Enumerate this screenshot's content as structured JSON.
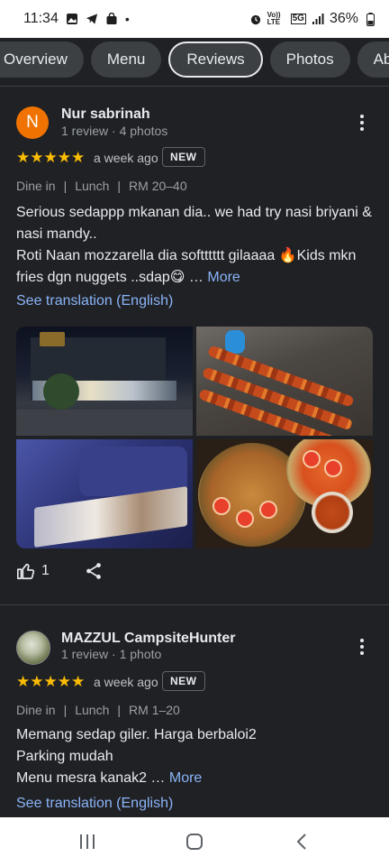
{
  "status_bar": {
    "time": "11:34",
    "notification_icons": [
      "image-icon",
      "telegram-icon",
      "shop-icon"
    ],
    "dot": "•",
    "right_icons": [
      "alarm-icon",
      "volte-icon",
      "5g-icon",
      "signal-icon"
    ],
    "volte_text": "Vo)) LTE",
    "network": "5G",
    "battery": "36%"
  },
  "tabs": [
    {
      "label": "Overview",
      "active": false
    },
    {
      "label": "Menu",
      "active": false
    },
    {
      "label": "Reviews",
      "active": true
    },
    {
      "label": "Photos",
      "active": false
    },
    {
      "label": "About",
      "active": false
    }
  ],
  "reviews": [
    {
      "avatar_letter": "N",
      "avatar_color": "#f07200",
      "name": "Nur sabrinah",
      "meta": "1 review · 4 photos",
      "rating": 5,
      "stars": "★★★★★",
      "time_ago": "a week ago",
      "badge": "NEW",
      "tags": [
        "Dine in",
        "|",
        "Lunch",
        "|",
        "RM 20–40"
      ],
      "text_line1": "Serious sedappp mkanan dia.. we had try nasi briyani & nasi mandy..",
      "text_line2": "Roti Naan mozzarella dia softttttt gilaaaa 🔥Kids mkn fries dgn nuggets ..sdap😋 …",
      "more": "More",
      "see_translation": "See translation (English)",
      "photo_count": 4,
      "likes": "1"
    },
    {
      "name": "MAZZUL CampsiteHunter",
      "meta": "1 review · 1 photo",
      "rating": 5,
      "stars": "★★★★★",
      "time_ago": "a week ago",
      "badge": "NEW",
      "tags": [
        "Dine in",
        "|",
        "Lunch",
        "|",
        "RM 1–20"
      ],
      "text_line1": "Memang sedap giler. Harga berbaloi2",
      "text_line2": "Parking mudah",
      "text_line3": "Menu mesra kanak2 …",
      "more": "More",
      "see_translation": "See translation (English)"
    }
  ],
  "colors": {
    "background": "#202124",
    "star": "#fbbc04",
    "link": "#8ab4f8",
    "text": "#e8eaed",
    "secondary_text": "#9aa0a6"
  },
  "nav_bar": {
    "buttons": [
      "recent-apps-icon",
      "home-icon",
      "back-icon"
    ]
  }
}
